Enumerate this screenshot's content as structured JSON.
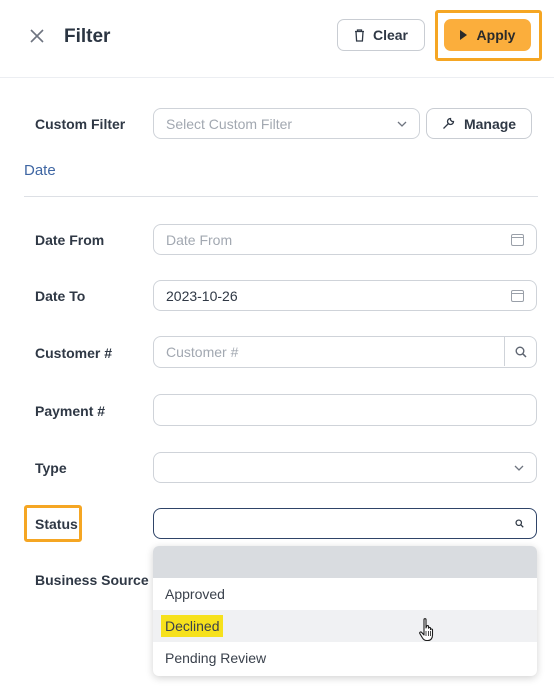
{
  "header": {
    "title": "Filter",
    "clear_label": "Clear",
    "apply_label": "Apply"
  },
  "custom_filter": {
    "label": "Custom Filter",
    "placeholder": "Select Custom Filter",
    "manage_label": "Manage"
  },
  "section": {
    "date_title": "Date"
  },
  "fields": {
    "date_from": {
      "label": "Date From",
      "placeholder": "Date From",
      "value": ""
    },
    "date_to": {
      "label": "Date To",
      "value": "2023-10-26"
    },
    "customer": {
      "label": "Customer #",
      "placeholder": "Customer #",
      "value": ""
    },
    "payment": {
      "label": "Payment #",
      "value": ""
    },
    "type": {
      "label": "Type",
      "value": ""
    },
    "status": {
      "label": "Status",
      "value": ""
    },
    "business_source": {
      "label": "Business Source"
    }
  },
  "status_options": [
    "Approved",
    "Declined",
    "Pending Review"
  ],
  "colors": {
    "accent": "#fbae3c",
    "highlight_box": "#f5a623",
    "section_title": "#3f66a3",
    "option_highlight": "#f6e11c"
  },
  "icons": {
    "close": "close-icon",
    "clear": "trash-icon",
    "apply": "play-icon",
    "manage": "wrench-icon",
    "calendar": "calendar-icon",
    "search": "search-icon",
    "dropdown": "chevron-down-icon",
    "cursor": "hand-pointer-icon"
  }
}
